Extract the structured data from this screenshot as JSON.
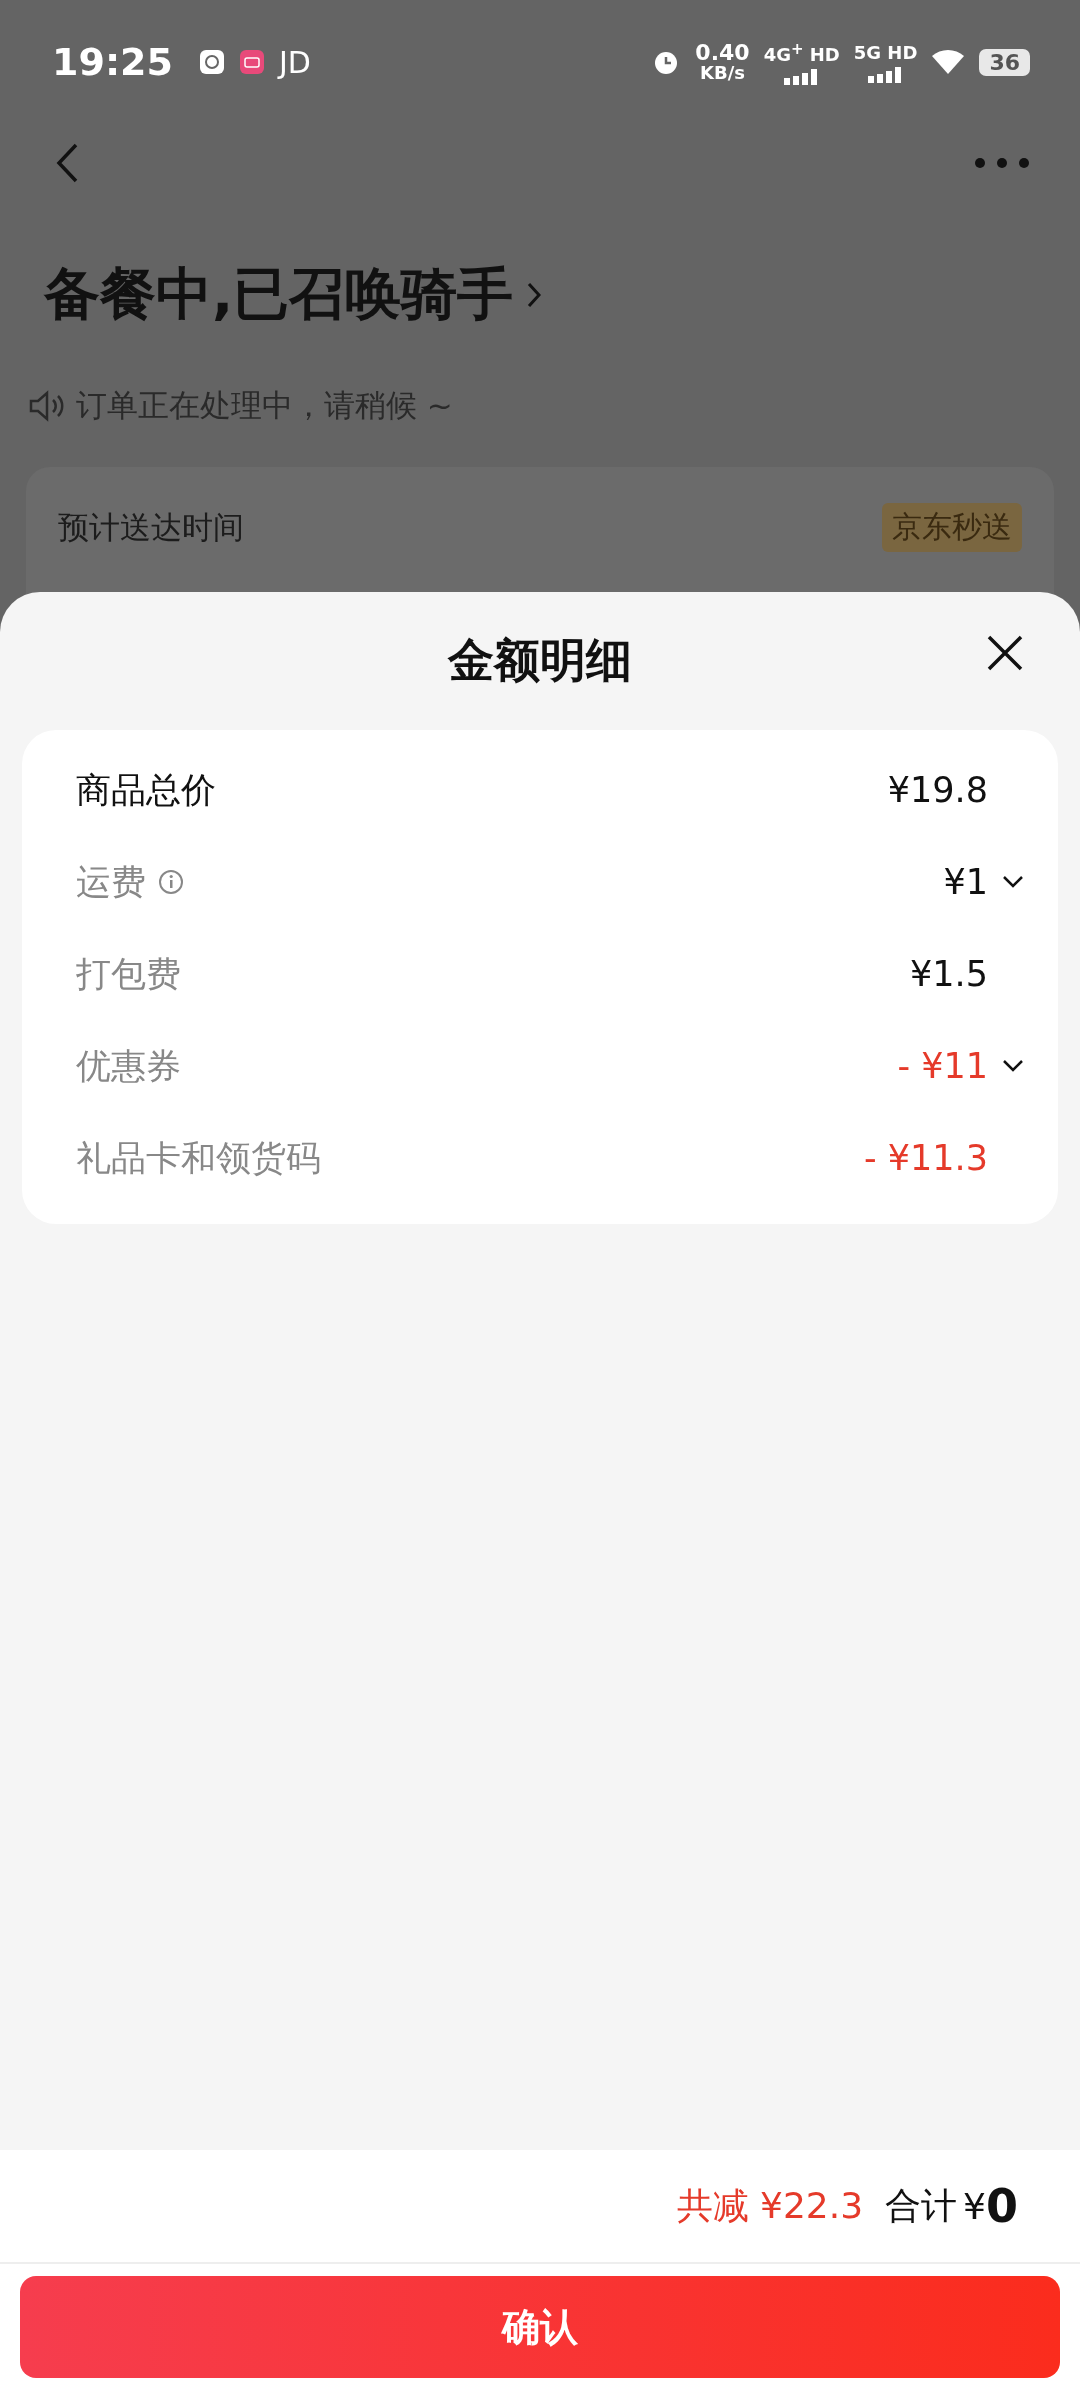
{
  "status_bar": {
    "time": "19:25",
    "app_label": "JD",
    "speed_value": "0.40",
    "speed_unit": "KB/s",
    "network_1": "4G$^{+}$ HD",
    "network_2": "5G HD",
    "battery": "36"
  },
  "order": {
    "title": "备餐中,已召唤骑手",
    "notice": "订单正在处理中，请稍候 ~",
    "delivery_label": "预计送达时间",
    "delivery_badge": "京东秒送"
  },
  "sheet": {
    "title": "金额明细",
    "rows": [
      {
        "kind": "subtotal",
        "label": "商品总价",
        "value": "¥19.8",
        "info": false,
        "expandable": false
      },
      {
        "kind": "fee",
        "label": "运费",
        "value": "¥1",
        "info": true,
        "expandable": true
      },
      {
        "kind": "fee",
        "label": "打包费",
        "value": "¥1.5",
        "info": false,
        "expandable": false
      },
      {
        "kind": "discount",
        "label": "优惠券",
        "value": "- ¥11",
        "info": false,
        "expandable": true
      },
      {
        "kind": "discount",
        "label": "礼品卡和领货码",
        "value": "- ¥11.3",
        "info": false,
        "expandable": false
      }
    ]
  },
  "summary": {
    "discount": "共减 ¥22.3",
    "total_label": "合计",
    "currency": "¥",
    "amount": "0"
  },
  "confirm_button": "确认"
}
